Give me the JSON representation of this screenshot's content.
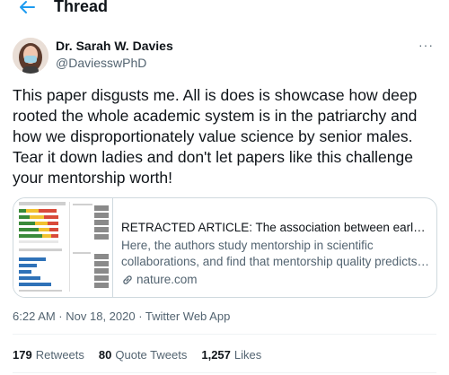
{
  "header": {
    "title": "Thread",
    "back_icon": "arrow-left-icon",
    "accent": "#1d9bf0"
  },
  "author": {
    "name": "Dr. Sarah W. Davies",
    "handle": "@DaviesswPhD",
    "avatar_icon": "user-avatar"
  },
  "more_label": "···",
  "tweet": {
    "text": "This paper disgusts me. All is does is showcase how deep rooted the whole academic system is in the patriarchy and how we disproportionately value science by senior males. Tear it down ladies and don't let papers like this challenge your mentorship worth!"
  },
  "card": {
    "title": "RETRACTED ARTICLE: The association between early car...",
    "description": "Here, the authors study mentorship in scientific collaborations, and find that mentorship quality predicts t...",
    "domain": "nature.com",
    "link_icon": "link-icon"
  },
  "meta": "6:22 AM · Nov 18, 2020 · Twitter Web App",
  "stats": [
    {
      "count": "179",
      "label": "Retweets"
    },
    {
      "count": "80",
      "label": "Quote Tweets"
    },
    {
      "count": "1,257",
      "label": "Likes"
    }
  ]
}
